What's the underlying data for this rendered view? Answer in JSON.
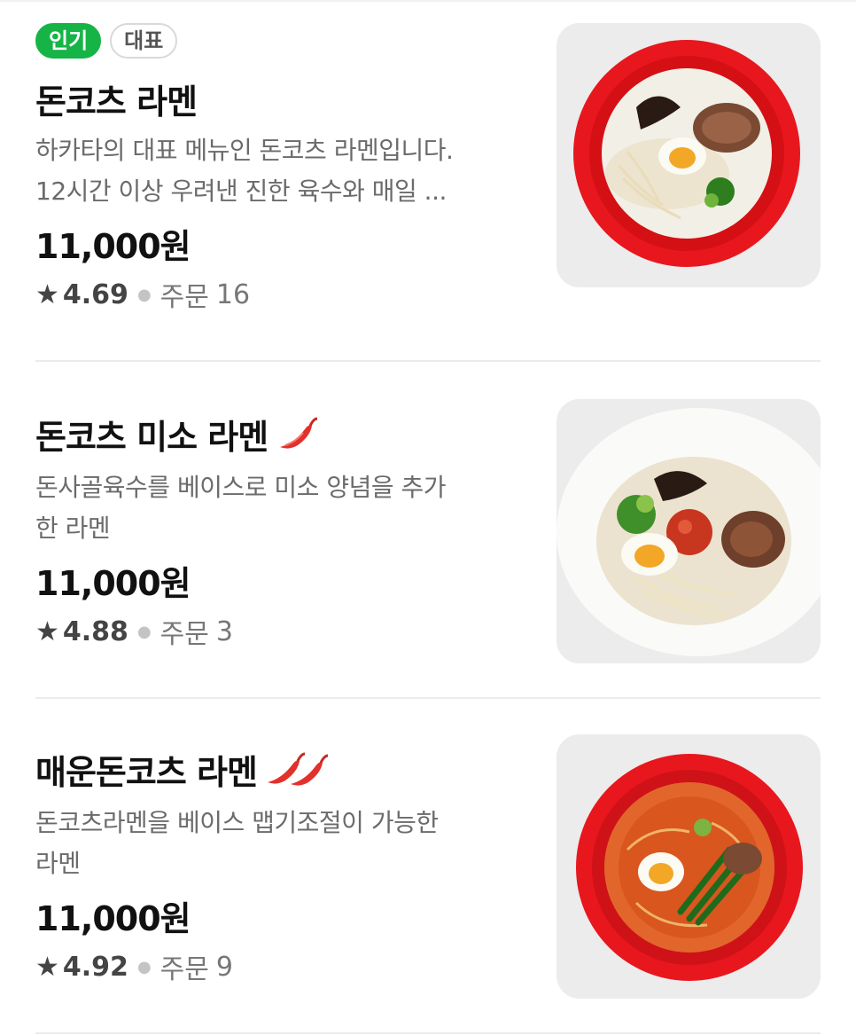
{
  "menu": {
    "items": [
      {
        "badges": [
          "인기",
          "대표"
        ],
        "name": "돈코츠 라멘",
        "spice_level": 0,
        "description_lines": [
          "하카타의 대표 메뉴인 돈코츠 라멘입니다.",
          "12시간 이상 우려낸 진한 육수와 매일 ..."
        ],
        "price": "11,000원",
        "rating": "4.69",
        "order_label": "주문",
        "order_count": "16",
        "image_icon": "tonkotsu-ramen-red-bowl"
      },
      {
        "badges": [],
        "name": "돈코츠 미소 라멘",
        "spice_level": 1,
        "description_lines": [
          "돈사골육수를 베이스로 미소 양념을 추가",
          "한 라멘"
        ],
        "price": "11,000원",
        "rating": "4.88",
        "order_label": "주문",
        "order_count": "3",
        "image_icon": "miso-ramen-white-bowl"
      },
      {
        "badges": [],
        "name": "매운돈코츠 라멘",
        "spice_level": 2,
        "description_lines": [
          "돈코츠라멘을 베이스 맵기조절이 가능한",
          "라멘"
        ],
        "price": "11,000원",
        "rating": "4.92",
        "order_label": "주문",
        "order_count": "9",
        "image_icon": "spicy-ramen-red-bowl"
      }
    ]
  },
  "colors": {
    "badge_popular": "#16b447",
    "chili": "#e2302a",
    "bowl_red": "#e8171d"
  },
  "icons": {
    "star": "star-icon",
    "chili": "chili-pepper-icon"
  }
}
